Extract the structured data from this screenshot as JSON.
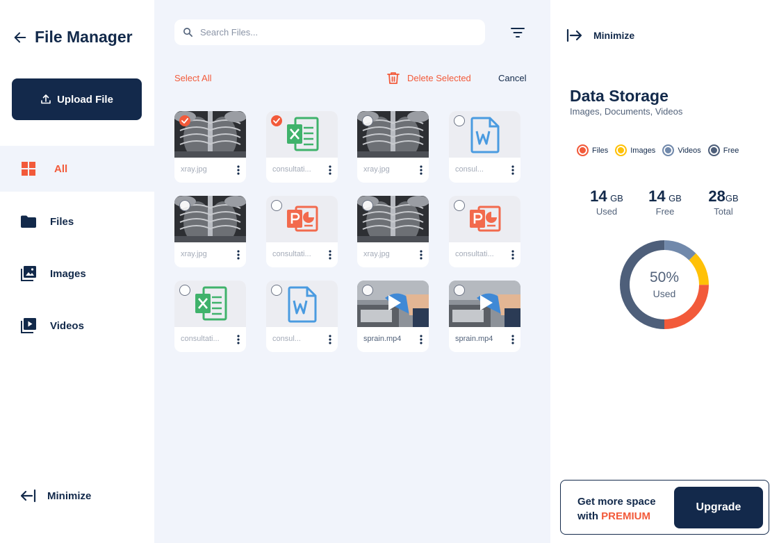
{
  "app": {
    "title": "File Manager"
  },
  "sidebar": {
    "upload_label": "Upload File",
    "items": [
      {
        "label": "All",
        "icon": "grid-icon",
        "active": true
      },
      {
        "label": "Files",
        "icon": "folder-icon",
        "active": false
      },
      {
        "label": "Images",
        "icon": "images-icon",
        "active": false
      },
      {
        "label": "Videos",
        "icon": "video-icon",
        "active": false
      }
    ],
    "minimize_label": "Minimize"
  },
  "main": {
    "search": {
      "placeholder": "Search Files..."
    },
    "toolbar": {
      "select_all": "Select All",
      "delete_selected": "Delete Selected",
      "cancel": "Cancel"
    },
    "files": [
      {
        "name": "xray.jpg",
        "kind": "xray",
        "checked": true
      },
      {
        "name": "consultation.xlsx",
        "kind": "excel",
        "checked": true
      },
      {
        "name": "xray.jpg",
        "kind": "xray",
        "checked": false
      },
      {
        "name": "consultation.docx",
        "kind": "word",
        "checked": false
      },
      {
        "name": "xray.jpg",
        "kind": "xray",
        "checked": false
      },
      {
        "name": "consultation.pptx",
        "kind": "ppt",
        "checked": false
      },
      {
        "name": "xray.jpg",
        "kind": "xray",
        "checked": false
      },
      {
        "name": "consultation.pptx",
        "kind": "ppt",
        "checked": false
      },
      {
        "name": "consultation.xlsx",
        "kind": "excel",
        "checked": false
      },
      {
        "name": "consultation.docx",
        "kind": "word",
        "checked": false
      },
      {
        "name": "sprain.mp4",
        "kind": "video",
        "checked": false
      },
      {
        "name": "sprain.mp4",
        "kind": "video",
        "checked": false
      }
    ],
    "display_names": [
      "xray.jpg",
      "consultati...",
      "xray.jpg",
      "consul...",
      "xray.jpg",
      "consultati...",
      "xray.jpg",
      "consultati...",
      "consultati...",
      "consul...",
      "sprain.mp4",
      "sprain.mp4"
    ]
  },
  "storage": {
    "minimize_label": "Minimize",
    "title": "Data Storage",
    "subtitle": "Images, Documents, Videos",
    "legend": [
      {
        "label": "Files",
        "color": "#f25a3a"
      },
      {
        "label": "Images",
        "color": "#ffc107"
      },
      {
        "label": "Videos",
        "color": "#7189ab"
      },
      {
        "label": "Free",
        "color": "#4e5f7a"
      }
    ],
    "used": {
      "value": "14",
      "unit": "GB",
      "label": "Used"
    },
    "free": {
      "value": "14",
      "unit": "GB",
      "label": "Free"
    },
    "total": {
      "value": "28",
      "unit": "GB",
      "label": "Total"
    },
    "donut": {
      "percent_label": "50%",
      "label": "Used"
    },
    "promo": {
      "line1": "Get more space",
      "line2_prefix": "with",
      "line2_highlight": "PREMIUM",
      "button": "Upgrade"
    }
  },
  "chart_data": {
    "type": "pie",
    "categories": [
      "Files",
      "Images",
      "Videos",
      "Free"
    ],
    "values": [
      25,
      12.5,
      12.5,
      50
    ],
    "title": "Data Storage"
  }
}
